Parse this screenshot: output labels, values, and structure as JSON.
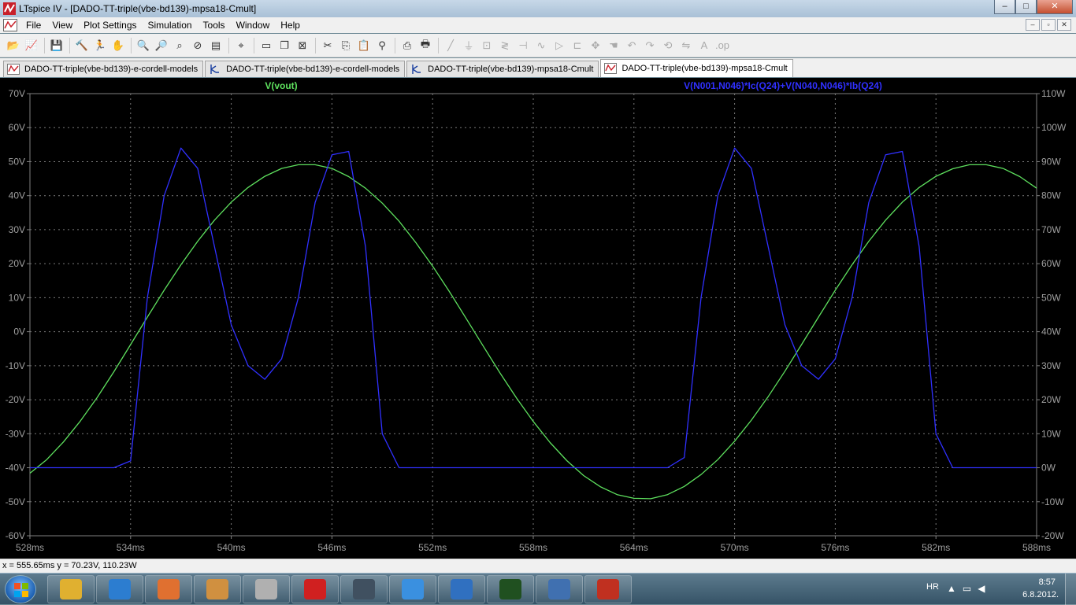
{
  "window": {
    "title": "LTspice IV - [DADO-TT-triple(vbe-bd139)-mpsa18-Cmult]",
    "minimize": "–",
    "maximize": "□",
    "close": "✕"
  },
  "menu": [
    "File",
    "View",
    "Plot Settings",
    "Simulation",
    "Tools",
    "Window",
    "Help"
  ],
  "mdi_buttons": [
    "–",
    "▫",
    "✕"
  ],
  "toolbar": {
    "icons": [
      "open-icon",
      "open-plot-icon",
      "save-icon",
      "control-panel-icon",
      "run-icon",
      "halt-icon",
      "zoom-in-icon",
      "zoom-out-icon",
      "zoom-fit-icon",
      "cancel-zoom-icon",
      "autorange-icon",
      "marker-icon",
      "tile-horizontal-icon",
      "cascade-icon",
      "close-all-icon",
      "cut-icon",
      "copy-icon",
      "paste-icon",
      "find-icon",
      "print-preview-icon",
      "print-icon",
      "wire-icon",
      "ground-icon",
      "label-icon",
      "resistor-icon",
      "capacitor-icon",
      "inductor-icon",
      "diode-icon",
      "component-icon",
      "move-icon",
      "drag-icon",
      "undo-icon",
      "redo-icon",
      "rotate-icon",
      "mirror-icon",
      "text-icon",
      "spice-directive-icon"
    ]
  },
  "tabs": [
    {
      "label": "DADO-TT-triple(vbe-bd139)-e-cordell-models",
      "icon": "waveform-icon",
      "active": false
    },
    {
      "label": "DADO-TT-triple(vbe-bd139)-e-cordell-models",
      "icon": "schematic-icon",
      "active": false
    },
    {
      "label": "DADO-TT-triple(vbe-bd139)-mpsa18-Cmult",
      "icon": "schematic-icon",
      "active": false
    },
    {
      "label": "DADO-TT-triple(vbe-bd139)-mpsa18-Cmult",
      "icon": "waveform-icon",
      "active": true
    }
  ],
  "chart_data": {
    "type": "line",
    "title": "",
    "x": [
      528,
      529,
      530,
      531,
      532,
      533,
      534,
      535,
      536,
      537,
      538,
      539,
      540,
      541,
      542,
      543,
      544,
      545,
      546,
      547,
      548,
      549,
      550,
      551,
      552,
      553,
      554,
      555,
      556,
      557,
      558,
      559,
      560,
      561,
      562,
      563,
      564,
      565,
      566,
      567,
      568,
      569,
      570,
      571,
      572,
      573,
      574,
      575,
      576,
      577,
      578,
      579,
      580,
      581,
      582,
      583,
      584,
      585,
      586,
      587,
      588
    ],
    "xlim": [
      528,
      588
    ],
    "x_ticks": [
      "528ms",
      "534ms",
      "540ms",
      "546ms",
      "552ms",
      "558ms",
      "564ms",
      "570ms",
      "576ms",
      "582ms",
      "588ms"
    ],
    "left_axis": {
      "ylim": [
        -60,
        70
      ],
      "ticks": [
        "70V",
        "60V",
        "50V",
        "40V",
        "30V",
        "20V",
        "10V",
        "0V",
        "-10V",
        "-20V",
        "-30V",
        "-40V",
        "-50V",
        "-60V"
      ]
    },
    "right_axis": {
      "ylim": [
        -20,
        110
      ],
      "ticks": [
        "110W",
        "100W",
        "90W",
        "80W",
        "70W",
        "60W",
        "50W",
        "40W",
        "30W",
        "20W",
        "10W",
        "0W",
        "-10W",
        "-20W"
      ]
    },
    "grid": true,
    "series": [
      {
        "name": "V(vout)",
        "axis": "left",
        "color": "#5ee05e",
        "values": [
          -41.6,
          -37.6,
          -32.4,
          -26.3,
          -19.4,
          -11.8,
          -3.8,
          4.3,
          12.2,
          19.7,
          26.6,
          32.8,
          38.1,
          42.4,
          45.7,
          48.0,
          49.1,
          49.1,
          48.0,
          45.6,
          42.2,
          37.8,
          32.5,
          26.2,
          19.3,
          11.8,
          3.9,
          -4.1,
          -12.0,
          -19.5,
          -26.4,
          -32.6,
          -37.9,
          -42.3,
          -45.6,
          -47.9,
          -49.0,
          -49.1,
          -47.9,
          -45.5,
          -42.0,
          -37.6,
          -32.2,
          -26.0,
          -19.1,
          -11.6,
          -3.7,
          4.3,
          12.2,
          19.7,
          26.6,
          32.8,
          38.1,
          42.4,
          45.7,
          47.9,
          49.1,
          49.1,
          48.0,
          45.6,
          42.2
        ]
      },
      {
        "name": "V(N001,N046)*Ic(Q24)+V(N040,N046)*Ib(Q24)",
        "axis": "right",
        "color": "#3030ff",
        "values": [
          0,
          0,
          0,
          0,
          0,
          0,
          2,
          50,
          80,
          94,
          88,
          65,
          42,
          30,
          26,
          32,
          50,
          78,
          92,
          93,
          65,
          10,
          0,
          0,
          0,
          0,
          0,
          0,
          0,
          0,
          0,
          0,
          0,
          0,
          0,
          0,
          0,
          0,
          0,
          3,
          50,
          80,
          94,
          88,
          65,
          42,
          30,
          26,
          32,
          50,
          78,
          92,
          93,
          65,
          10,
          0,
          0,
          0,
          0,
          0,
          0
        ]
      }
    ]
  },
  "status": {
    "cursor_readout": "x = 555.65ms   y = 70.23V, 110.23W"
  },
  "taskbar": {
    "apps": [
      {
        "icon": "explorer-icon",
        "color": "#e0b030"
      },
      {
        "icon": "media-player-icon",
        "color": "#2c7dd0"
      },
      {
        "icon": "folder-app-icon",
        "color": "#e07030"
      },
      {
        "icon": "document-app-icon",
        "color": "#d09040"
      },
      {
        "icon": "cad-app-icon",
        "color": "#b0b0b0"
      },
      {
        "icon": "security-app-icon",
        "color": "#d02020"
      },
      {
        "icon": "oscilloscope-app-icon",
        "color": "#405060"
      },
      {
        "icon": "internet-explorer-icon",
        "color": "#3a90e0"
      },
      {
        "icon": "chrome-icon",
        "color": "#3070c0"
      },
      {
        "icon": "ltspice-editor-icon",
        "color": "#205020"
      },
      {
        "icon": "word-pad-icon",
        "color": "#4070b0"
      },
      {
        "icon": "ltspice-icon",
        "color": "#c03020"
      }
    ],
    "language": "HR",
    "time": "8:57",
    "date": "6.8.2012."
  }
}
